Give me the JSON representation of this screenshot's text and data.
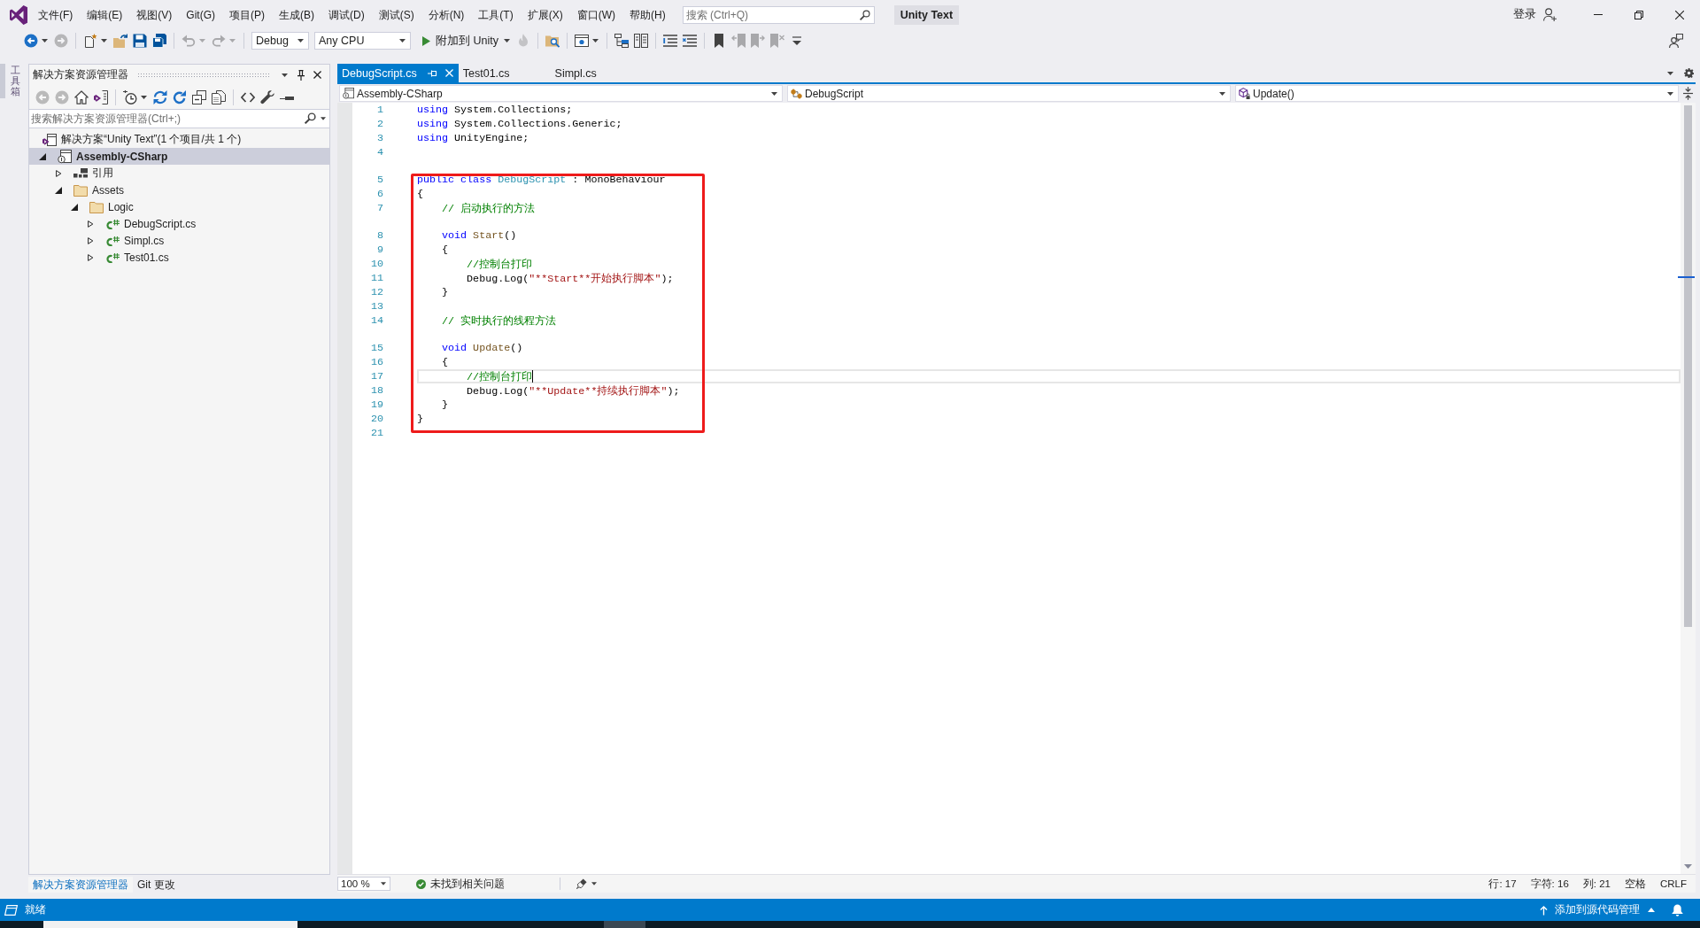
{
  "title_bar": {
    "menu": [
      "文件(F)",
      "编辑(E)",
      "视图(V)",
      "Git(G)",
      "项目(P)",
      "生成(B)",
      "调试(D)",
      "测试(S)",
      "分析(N)",
      "工具(T)",
      "扩展(X)",
      "窗口(W)",
      "帮助(H)"
    ],
    "search": {
      "placeholder": "搜索 (Ctrl+Q)"
    },
    "solution_name": "Unity Text",
    "sign_in": "登录"
  },
  "toolbar": {
    "items": [
      {
        "kind": "back",
        "disabled": false
      },
      {
        "kind": "forward",
        "disabled": true
      },
      {
        "kind": "separator"
      },
      {
        "kind": "new-project",
        "disabled": false
      },
      {
        "kind": "open",
        "disabled": false
      },
      {
        "kind": "save",
        "disabled": false
      },
      {
        "kind": "save-all",
        "disabled": false
      },
      {
        "kind": "separator"
      },
      {
        "kind": "undo",
        "disabled": true
      },
      {
        "kind": "redo",
        "disabled": true
      },
      {
        "kind": "separator"
      },
      {
        "kind": "combo",
        "value": "Debug"
      },
      {
        "kind": "combo",
        "value": "Any CPU"
      },
      {
        "kind": "run",
        "label": "附加到 Unity"
      },
      {
        "kind": "hot-reload",
        "disabled": true
      },
      {
        "kind": "separator"
      },
      {
        "kind": "find-in-files",
        "disabled": false
      },
      {
        "kind": "separator"
      },
      {
        "kind": "capture",
        "disabled": false
      },
      {
        "kind": "separator"
      },
      {
        "kind": "tree-view",
        "disabled": false
      },
      {
        "kind": "columns-view",
        "disabled": false
      },
      {
        "kind": "separator"
      },
      {
        "kind": "comment",
        "disabled": false
      },
      {
        "kind": "uncomment",
        "disabled": false
      },
      {
        "kind": "separator"
      },
      {
        "kind": "bookmark",
        "disabled": false
      },
      {
        "kind": "prev-bookmark",
        "disabled": true
      },
      {
        "kind": "next-bookmark",
        "disabled": true
      },
      {
        "kind": "clear-bookmarks",
        "disabled": true
      },
      {
        "kind": "overflow",
        "disabled": false
      }
    ]
  },
  "toolbox": {
    "label": "工具箱"
  },
  "solution_explorer": {
    "title": "解决方案资源管理器",
    "toolbar": [
      {
        "kind": "back",
        "disabled": true
      },
      {
        "kind": "forward",
        "disabled": true
      },
      {
        "kind": "home",
        "disabled": false
      },
      {
        "kind": "switch-views",
        "disabled": false
      },
      {
        "kind": "separator"
      },
      {
        "kind": "history",
        "disabled": false
      },
      {
        "kind": "sync",
        "disabled": false
      },
      {
        "kind": "refresh",
        "disabled": false
      },
      {
        "kind": "collapse-all",
        "disabled": false
      },
      {
        "kind": "show-all",
        "disabled": false
      },
      {
        "kind": "separator"
      },
      {
        "kind": "code",
        "disabled": false
      },
      {
        "kind": "properties",
        "disabled": false
      },
      {
        "kind": "preview",
        "disabled": false
      }
    ],
    "search": {
      "placeholder": "搜索解决方案资源管理器(Ctrl+;)"
    },
    "tree": {
      "kind": "solution",
      "label": "解决方案“Unity Text”(1 个项目/共 1 个)",
      "selected": false,
      "children": [
        {
          "kind": "project",
          "label": "Assembly-CSharp",
          "expanded": true,
          "selected": true,
          "children": [
            {
              "kind": "references",
              "label": "引用",
              "expanded": false,
              "selected": false
            },
            {
              "kind": "folder",
              "label": "Assets",
              "expanded": true,
              "selected": false,
              "children": [
                {
                  "kind": "folder",
                  "label": "Logic",
                  "expanded": true,
                  "selected": false,
                  "children": [
                    {
                      "kind": "csharp",
                      "label": "DebugScript.cs",
                      "expanded": false,
                      "selected": false
                    },
                    {
                      "kind": "csharp",
                      "label": "Simpl.cs",
                      "expanded": false,
                      "selected": false
                    },
                    {
                      "kind": "csharp",
                      "label": "Test01.cs",
                      "expanded": false,
                      "selected": false
                    }
                  ]
                }
              ]
            }
          ]
        }
      ]
    },
    "bottom_tabs": [
      {
        "label": "解决方案资源管理器",
        "selected": true
      },
      {
        "label": "Git 更改",
        "selected": false
      }
    ]
  },
  "editor": {
    "tabs": [
      {
        "label": "DebugScript.cs",
        "selected": true
      },
      {
        "label": "Test01.cs",
        "selected": false
      },
      {
        "label": "Simpl.cs",
        "selected": false
      }
    ],
    "nav": {
      "project": "Assembly-CSharp",
      "type": "DebugScript",
      "member": "Update()"
    },
    "code": [
      {
        "kind": "line",
        "number": "1",
        "current": false,
        "tokens": [
          {
            "kind": "keyword",
            "text": "using"
          },
          {
            "kind": "plain",
            "text": " System.Collections;"
          }
        ]
      },
      {
        "kind": "line",
        "number": "2",
        "current": false,
        "tokens": [
          {
            "kind": "keyword",
            "text": "using"
          },
          {
            "kind": "plain",
            "text": " System.Collections.Generic;"
          }
        ]
      },
      {
        "kind": "line",
        "number": "3",
        "current": false,
        "tokens": [
          {
            "kind": "keyword",
            "text": "using"
          },
          {
            "kind": "plain",
            "text": " UnityEngine;"
          }
        ]
      },
      {
        "kind": "line",
        "number": "4",
        "current": false
      },
      {
        "kind": "codelens"
      },
      {
        "kind": "box",
        "children": [
          {
            "kind": "line",
            "number": "5",
            "current": false,
            "tokens": [
              {
                "kind": "keyword",
                "text": "public class"
              },
              {
                "kind": "type",
                "text": " DebugScript"
              },
              {
                "kind": "plain",
                "text": " : MonoBehaviour"
              }
            ]
          },
          {
            "kind": "line",
            "number": "6",
            "current": false,
            "tokens": [
              {
                "kind": "plain",
                "text": "{"
              }
            ]
          },
          {
            "kind": "line",
            "number": "7",
            "current": false,
            "tokens": [
              {
                "kind": "comment",
                "text": "    // 启动执行的方法"
              }
            ]
          },
          {
            "kind": "codelens"
          },
          {
            "kind": "line",
            "number": "8",
            "current": false,
            "tokens": [
              {
                "kind": "keyword",
                "text": "    void"
              },
              {
                "kind": "method",
                "text": " Start"
              },
              {
                "kind": "plain",
                "text": "()"
              }
            ]
          },
          {
            "kind": "line",
            "number": "9",
            "current": false,
            "tokens": [
              {
                "kind": "plain",
                "text": "    {"
              }
            ]
          },
          {
            "kind": "line",
            "number": "10",
            "current": false,
            "tokens": [
              {
                "kind": "comment",
                "text": "        //控制台打印"
              }
            ]
          },
          {
            "kind": "line",
            "number": "11",
            "current": false,
            "tokens": [
              {
                "kind": "plain",
                "text": "        Debug.Log("
              },
              {
                "kind": "string",
                "text": "\"**Start**开始执行脚本\""
              },
              {
                "kind": "plain",
                "text": ");"
              }
            ]
          },
          {
            "kind": "line",
            "number": "12",
            "current": false,
            "tokens": [
              {
                "kind": "plain",
                "text": "    }"
              }
            ]
          },
          {
            "kind": "line",
            "number": "13",
            "current": false
          },
          {
            "kind": "line",
            "number": "14",
            "current": false,
            "tokens": [
              {
                "kind": "comment",
                "text": "    // 实时执行的线程方法"
              }
            ]
          },
          {
            "kind": "codelens"
          },
          {
            "kind": "line",
            "number": "15",
            "current": false,
            "tokens": [
              {
                "kind": "keyword",
                "text": "    void"
              },
              {
                "kind": "method",
                "text": " Update"
              },
              {
                "kind": "plain",
                "text": "()"
              }
            ]
          },
          {
            "kind": "line",
            "number": "16",
            "current": false,
            "tokens": [
              {
                "kind": "plain",
                "text": "    {"
              }
            ]
          },
          {
            "kind": "line",
            "number": "17",
            "current": true,
            "tokens": [
              {
                "kind": "comment",
                "text": "        //控制台打印"
              }
            ]
          },
          {
            "kind": "line",
            "number": "18",
            "current": false,
            "tokens": [
              {
                "kind": "plain",
                "text": "        Debug.Log("
              },
              {
                "kind": "string",
                "text": "\"**Update**持续执行脚本\""
              },
              {
                "kind": "plain",
                "text": ");"
              }
            ]
          },
          {
            "kind": "line",
            "number": "19",
            "current": false,
            "tokens": [
              {
                "kind": "plain",
                "text": "    }"
              }
            ]
          },
          {
            "kind": "line",
            "number": "20",
            "current": false,
            "tokens": [
              {
                "kind": "plain",
                "text": "}"
              }
            ]
          }
        ]
      },
      {
        "kind": "line",
        "number": "21",
        "current": false
      }
    ],
    "status": {
      "zoom": "100 %",
      "issues": "未找到相关问题",
      "line": "行: 17",
      "char": "字符: 16",
      "column": "列: 21",
      "indent": "空格",
      "line_ending": "CRLF"
    }
  },
  "status_bar": {
    "message": "就绪",
    "source_control": "添加到源代码管理"
  }
}
